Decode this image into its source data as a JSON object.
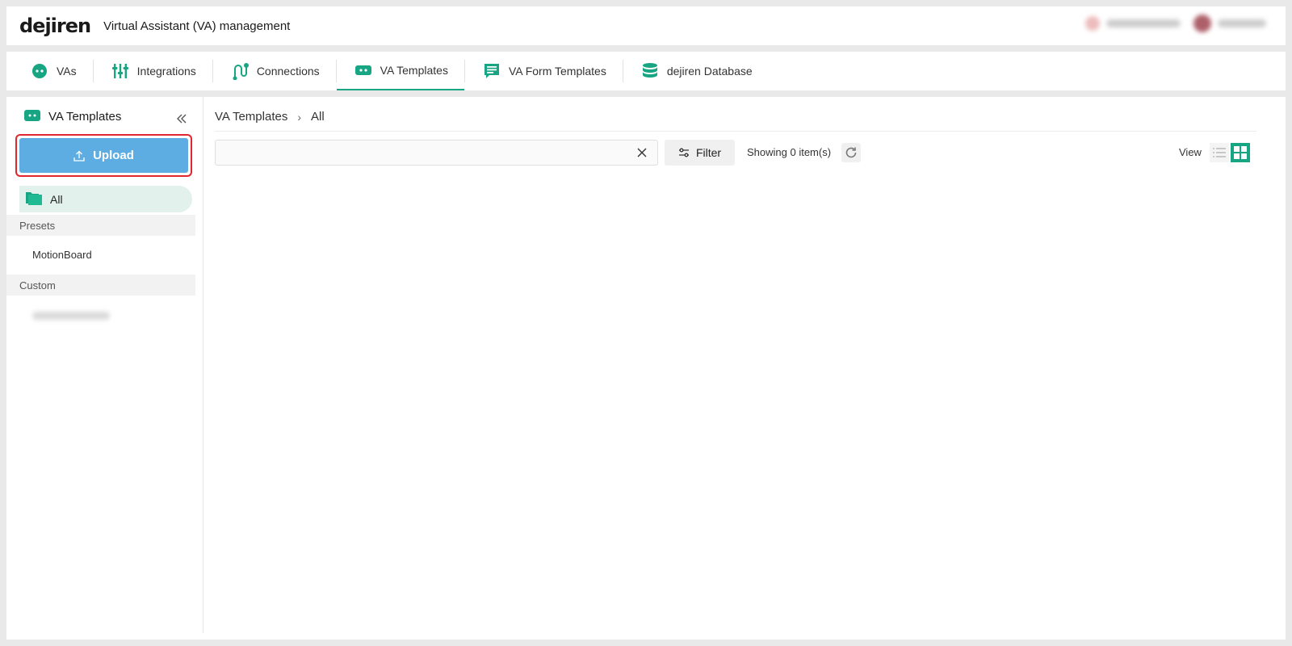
{
  "header": {
    "logo": "dejiren",
    "title": "Virtual Assistant (VA) management"
  },
  "tabs": [
    {
      "label": "VAs",
      "icon": "robot-face-icon"
    },
    {
      "label": "Integrations",
      "icon": "sliders-icon"
    },
    {
      "label": "Connections",
      "icon": "connection-icon"
    },
    {
      "label": "VA Templates",
      "icon": "template-icon",
      "active": true
    },
    {
      "label": "VA Form Templates",
      "icon": "form-template-icon"
    },
    {
      "label": "dejiren Database",
      "icon": "database-icon"
    }
  ],
  "sidebar": {
    "title": "VA Templates",
    "upload_label": "Upload",
    "all_label": "All",
    "presets_header": "Presets",
    "presets": [
      "MotionBoard"
    ],
    "custom_header": "Custom"
  },
  "content": {
    "breadcrumb": [
      "VA Templates",
      "All"
    ],
    "breadcrumb_sep": "›",
    "search_placeholder": "",
    "filter_label": "Filter",
    "showing_text": "Showing 0 item(s)",
    "view_label": "View"
  },
  "colors": {
    "accent": "#17a584",
    "upload_button": "#5dade2",
    "highlight_outline": "#e0262f",
    "selected_folder_bg": "#e2f1eb"
  }
}
